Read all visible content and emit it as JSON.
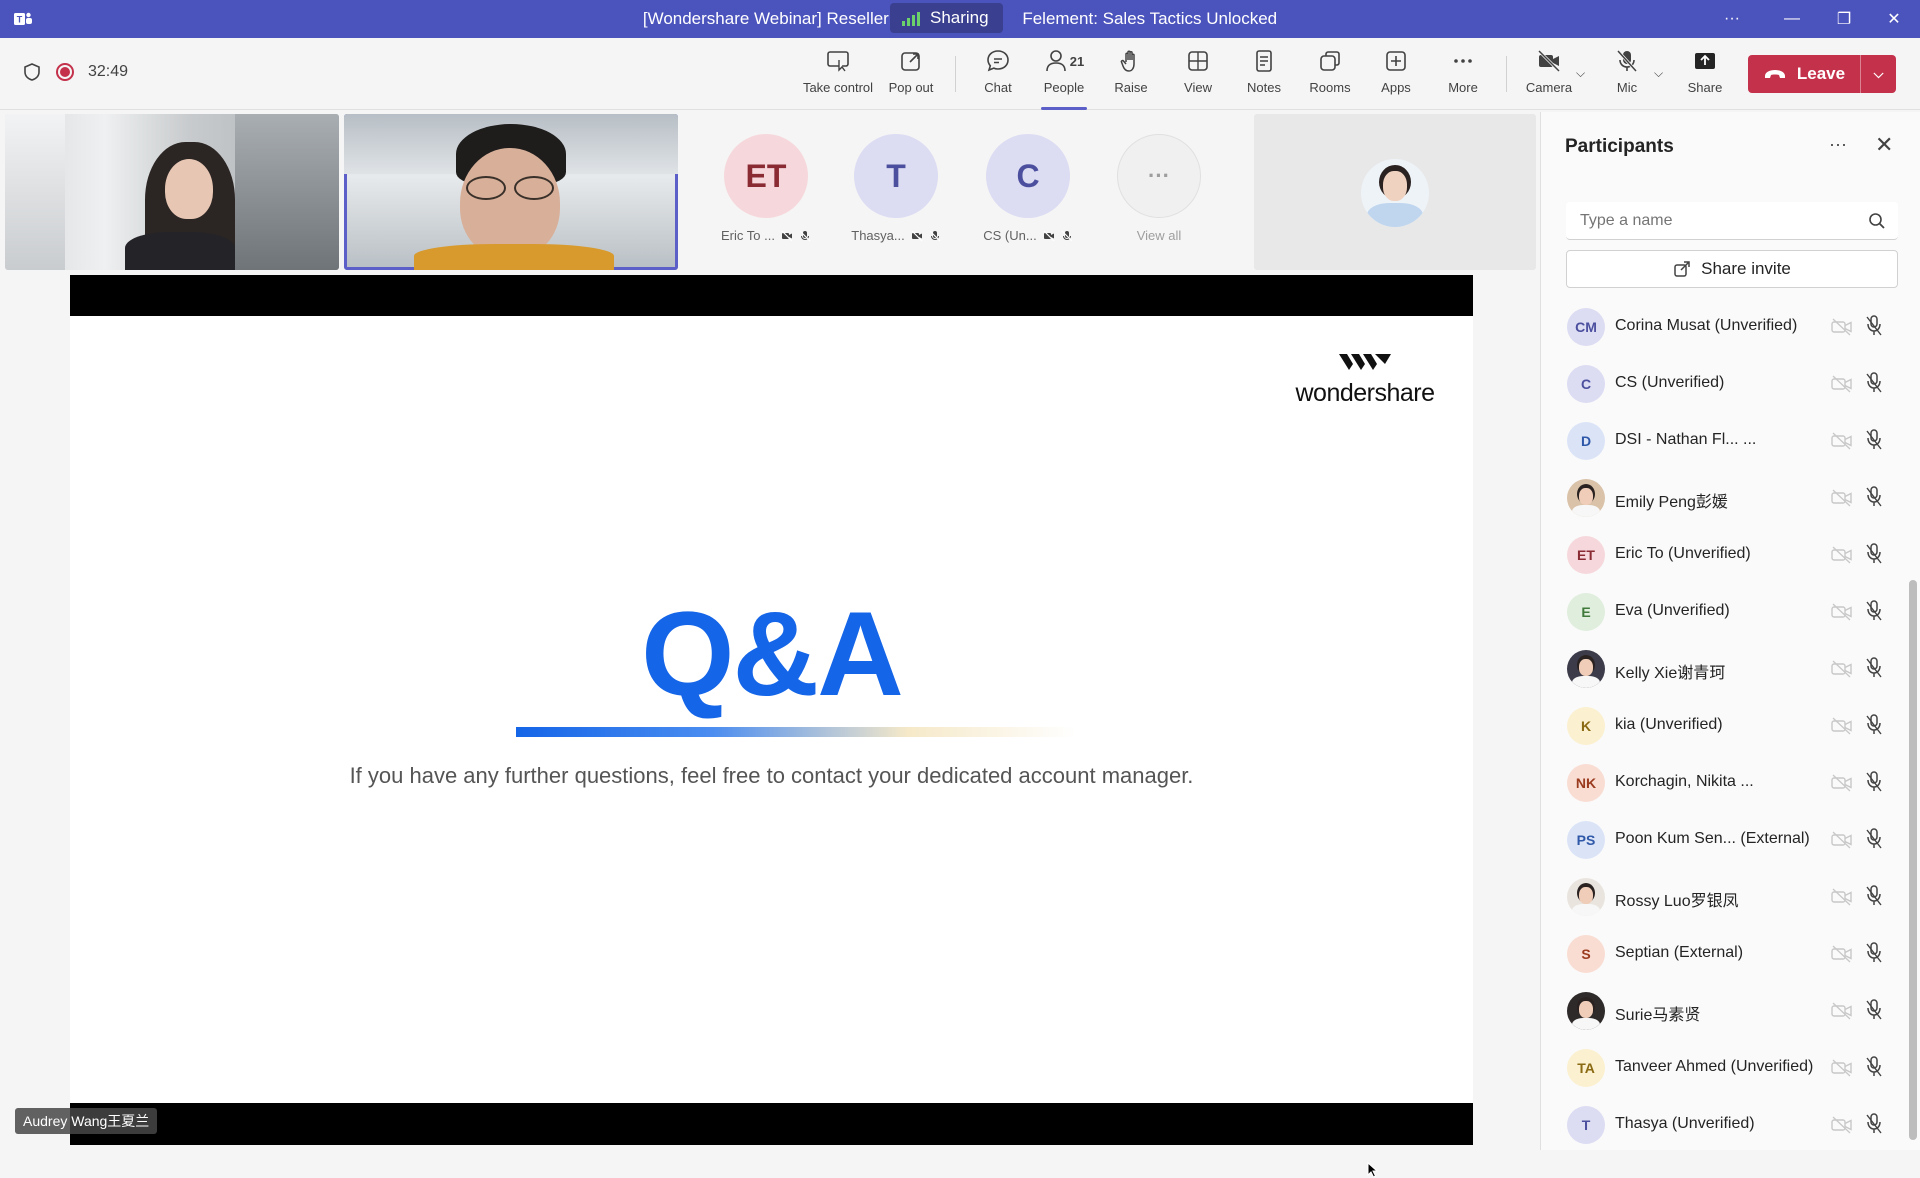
{
  "window": {
    "title_left": "[Wondershare Webinar] Reseller",
    "title_right": "Felement: Sales Tactics Unlocked",
    "sharing_label": "Sharing",
    "more_glyph": "···",
    "minimize_glyph": "—",
    "restore_glyph": "❐",
    "close_glyph": "✕"
  },
  "toolbar": {
    "timer": "32:49",
    "buttons": {
      "take_control": "Take control",
      "pop_out": "Pop out",
      "chat": "Chat",
      "people": "People",
      "people_count": "21",
      "raise": "Raise",
      "view": "View",
      "notes": "Notes",
      "rooms": "Rooms",
      "apps": "Apps",
      "more": "More",
      "camera": "Camera",
      "mic": "Mic",
      "share": "Share"
    },
    "leave_label": "Leave"
  },
  "gallery": {
    "avatars": [
      {
        "initials": "ET",
        "name": "Eric To ...",
        "bg": "#f6d8dc",
        "fg": "#8a2a33"
      },
      {
        "initials": "T",
        "name": "Thasya...",
        "bg": "#dcdcf3",
        "fg": "#4b4f9e"
      },
      {
        "initials": "C",
        "name": "CS (Un...",
        "bg": "#dcdcf3",
        "fg": "#4b4f9e"
      }
    ],
    "view_all_label": "View all",
    "view_all_glyph": "···"
  },
  "slide": {
    "logo_text": "wondershare",
    "heading": "Q&A",
    "subtitle": "If you have any further questions, feel free to contact your dedicated account manager."
  },
  "speaker_name": "Audrey Wang王夏兰",
  "participants": {
    "title": "Participants",
    "more_glyph": "···",
    "close_glyph": "✕",
    "search_placeholder": "Type a name",
    "share_invite_label": "Share invite",
    "list": [
      {
        "initials": "CM",
        "name": "Corina Musat (Unverified)",
        "bg": "#dcdcf3",
        "fg": "#4b4f9e",
        "photo": false
      },
      {
        "initials": "C",
        "name": "CS (Unverified)",
        "bg": "#dcdcf3",
        "fg": "#4b4f9e",
        "photo": false
      },
      {
        "initials": "D",
        "name": "DSI - Nathan Fl... ...",
        "bg": "#dbe4f7",
        "fg": "#2f58a8",
        "photo": false
      },
      {
        "initials": "",
        "name": "Emily Peng彭媛",
        "bg": "#d9c2a8",
        "fg": "#5a3f27",
        "photo": true
      },
      {
        "initials": "ET",
        "name": "Eric To (Unverified)",
        "bg": "#f6d8dc",
        "fg": "#8a2a33",
        "photo": false
      },
      {
        "initials": "E",
        "name": "Eva (Unverified)",
        "bg": "#dfeedd",
        "fg": "#3f7a3a",
        "photo": false
      },
      {
        "initials": "",
        "name": "Kelly Xie谢青珂",
        "bg": "#3b3b4a",
        "fg": "#ffffff",
        "photo": true
      },
      {
        "initials": "K",
        "name": "kia (Unverified)",
        "bg": "#fbf0cf",
        "fg": "#8a6a12",
        "photo": false
      },
      {
        "initials": "NK",
        "name": "Korchagin, Nikita ...",
        "bg": "#f9ddd3",
        "fg": "#9a3a1e",
        "photo": false
      },
      {
        "initials": "PS",
        "name": "Poon Kum Sen...  (External)",
        "bg": "#dbe4f7",
        "fg": "#2f58a8",
        "photo": false
      },
      {
        "initials": "",
        "name": "Rossy Luo罗银凤",
        "bg": "#e9e4de",
        "fg": "#333333",
        "photo": true
      },
      {
        "initials": "S",
        "name": "Septian (External)",
        "bg": "#f9ddd3",
        "fg": "#9a3a1e",
        "photo": false
      },
      {
        "initials": "",
        "name": "Surie马素贤",
        "bg": "#2f2a2a",
        "fg": "#ffffff",
        "photo": true
      },
      {
        "initials": "TA",
        "name": "Tanveer Ahmed (Unverified)",
        "bg": "#fbf0cf",
        "fg": "#8a6a12",
        "photo": false
      },
      {
        "initials": "T",
        "name": "Thasya (Unverified)",
        "bg": "#dcdcf3",
        "fg": "#4b4f9e",
        "photo": false
      }
    ]
  },
  "colors": {
    "titlebar": "#4b53bc",
    "leave": "#c4314b",
    "accent": "#5b5fc7",
    "slide_blue": "#1565e8"
  }
}
